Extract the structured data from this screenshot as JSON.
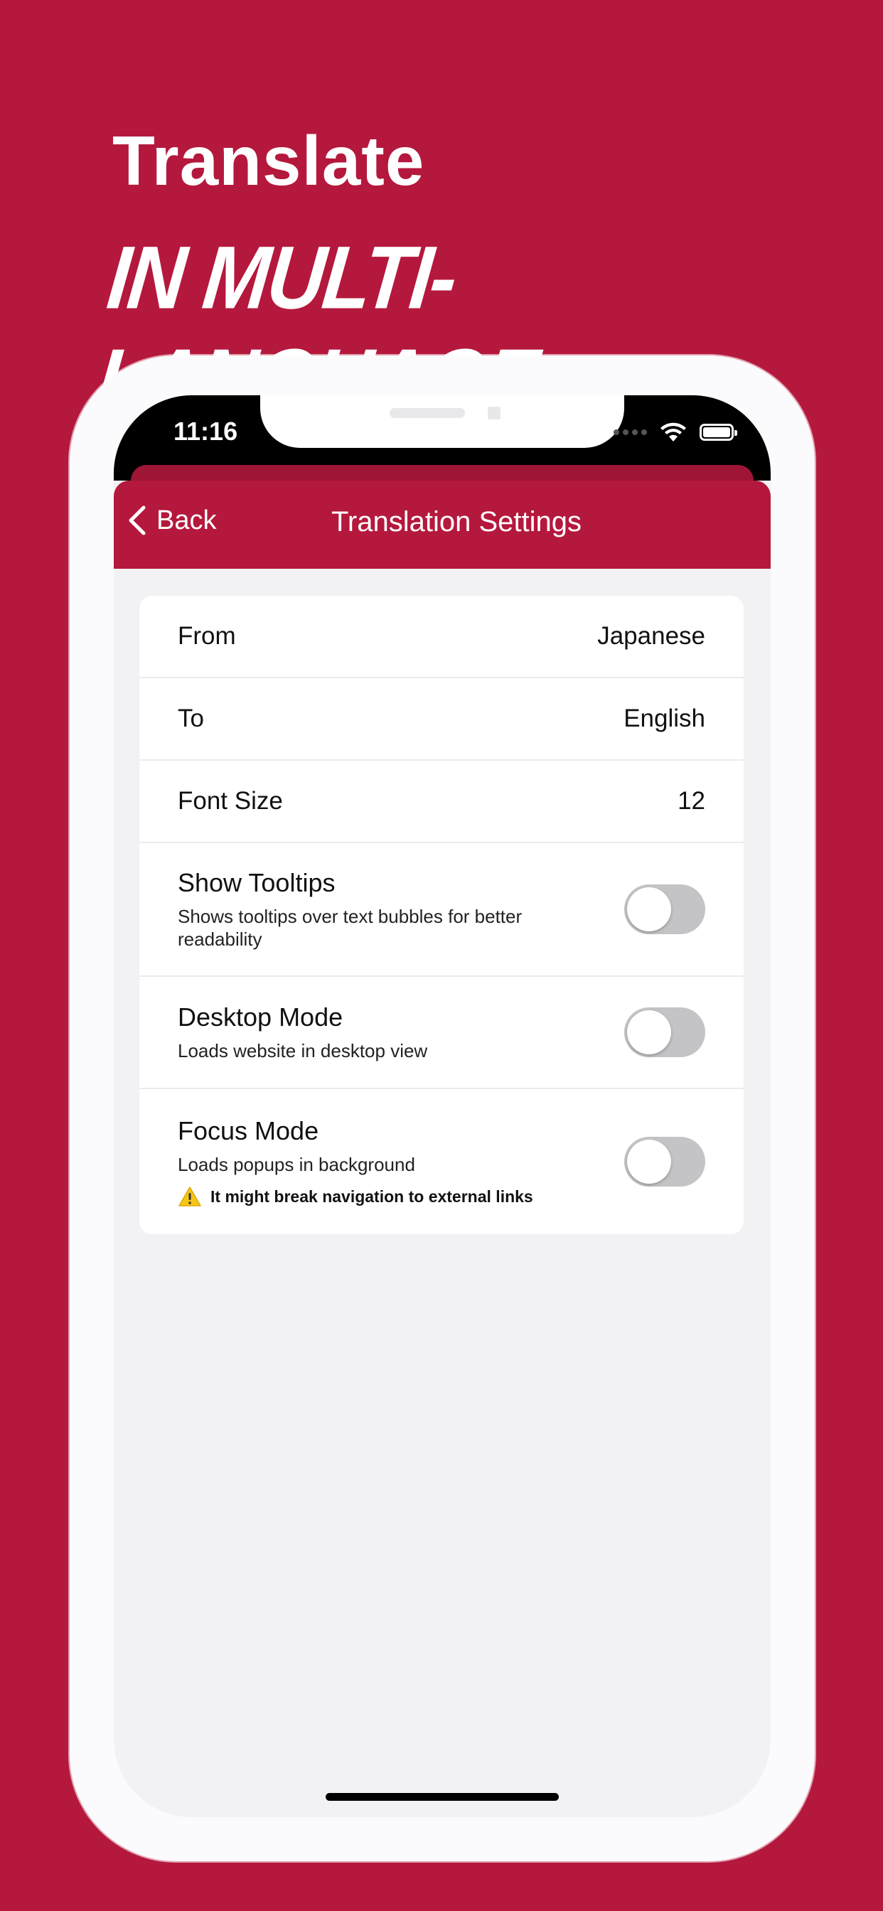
{
  "hero": {
    "line1": "Translate",
    "line2": "IN MULTI-LANGUAGE"
  },
  "status_bar": {
    "time": "11:16",
    "icons": [
      "signal-icon",
      "wifi-icon",
      "battery-icon"
    ]
  },
  "nav": {
    "back_label": "Back",
    "title": "Translation Settings"
  },
  "settings": {
    "from": {
      "label": "From",
      "value": "Japanese"
    },
    "to": {
      "label": "To",
      "value": "English"
    },
    "font_size": {
      "label": "Font Size",
      "value": "12"
    },
    "show_tooltips": {
      "title": "Show Tooltips",
      "subtitle": "Shows tooltips over text bubbles for better readability",
      "enabled": false
    },
    "desktop_mode": {
      "title": "Desktop Mode",
      "subtitle": "Loads website in desktop view",
      "enabled": false
    },
    "focus_mode": {
      "title": "Focus Mode",
      "subtitle": "Loads popups in background",
      "warning": "It might break navigation to external links",
      "enabled": false
    }
  },
  "colors": {
    "brand": "#B5183D",
    "toggle_off": "#C4C4C6",
    "background": "#F2F1F4",
    "warning": "#F5C518"
  }
}
